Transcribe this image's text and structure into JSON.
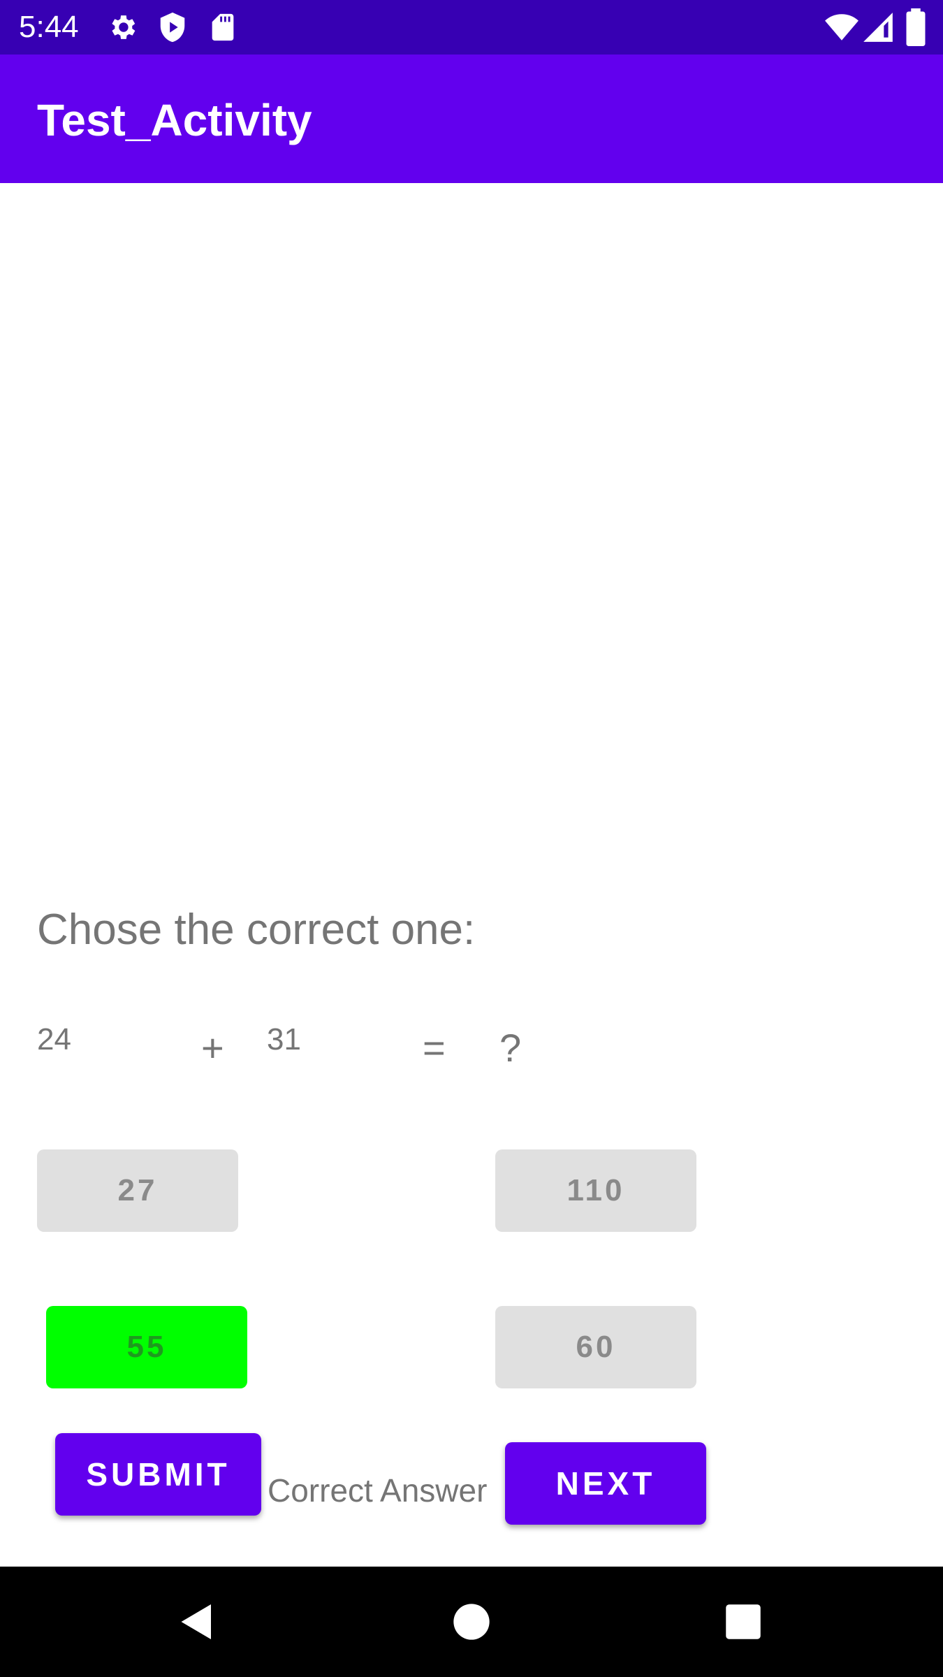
{
  "status_bar": {
    "time": "5:44",
    "icons": [
      "gear-icon",
      "shield-play-icon",
      "sd-card-icon",
      "wifi-icon",
      "signal-icon",
      "battery-icon"
    ]
  },
  "app_bar": {
    "title": "Test_Activity",
    "color": "#6200EE"
  },
  "quiz": {
    "prompt": "Chose the correct one:",
    "operand_a": "24",
    "operator": "+",
    "operand_b": "31",
    "equals": "=",
    "unknown": "?",
    "options": [
      "27",
      "110",
      "55",
      "60"
    ],
    "selected_option": "55",
    "selected_color": "#00FF00"
  },
  "actions": {
    "submit_label": "SUBMIT",
    "next_label": "NEXT",
    "result_text": "Correct Answer"
  },
  "nav_bar": {
    "buttons": [
      "back-icon",
      "home-icon",
      "recents-icon"
    ]
  }
}
